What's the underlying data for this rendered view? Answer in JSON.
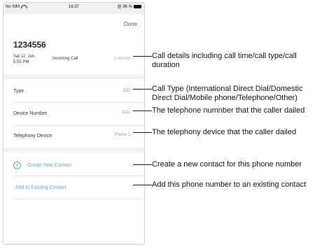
{
  "status_bar": {
    "carrier": "No SIM",
    "time": "16:37",
    "battery": "@ 96 %"
  },
  "header": {
    "done_label": "Done"
  },
  "call": {
    "number": "1234556",
    "date_line1": "Sat 12, Jun,",
    "date_line2": "5:55 PM",
    "type": "Incoming Call",
    "duration": "1 minute"
  },
  "details": [
    {
      "label": "Type",
      "value": "IDD"
    },
    {
      "label": "Device Number",
      "value": "1111"
    },
    {
      "label": "Telephony Device",
      "value": "Phone 1"
    }
  ],
  "actions": {
    "create": "Create New Contact",
    "add": "Add to Existing Contact"
  },
  "annotations": {
    "call_details": "Call details including call time/call type/call duration",
    "call_type_l1": "Call Type (International Direct Dial/Domestic",
    "call_type_l2": "Direct Dial/Mobile phone/Telephone/Other)",
    "device_number": "The telephone numnber that the caller dailed",
    "telephony_device": "The telephony device that the caller dailed",
    "create_contact": "Create a new contact for this phone number",
    "add_contact": "Add this phone number to an existing contact"
  }
}
